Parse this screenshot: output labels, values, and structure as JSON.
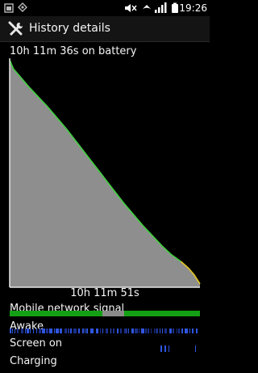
{
  "status_bar": {
    "time": "19:26",
    "icons": [
      "notification-icon",
      "usb-debug-icon",
      "mute-icon",
      "wifi-icon",
      "signal-icon",
      "battery-icon"
    ]
  },
  "header": {
    "title": "History details",
    "icon": "wrench-screwdriver-icon"
  },
  "battery": {
    "time_on_battery": "10h 11m 36s on battery",
    "graph_duration": "10h 11m 51s"
  },
  "rows": {
    "mobile_signal": "Mobile network signal",
    "awake": "Awake",
    "screen_on": "Screen on",
    "charging": "Charging"
  },
  "chart_data": {
    "type": "area",
    "title": "10h 11m 36s on battery",
    "xlabel": "10h 11m 51s",
    "ylabel": "",
    "x": [
      0,
      0.02,
      0.05,
      0.1,
      0.2,
      0.3,
      0.4,
      0.5,
      0.6,
      0.7,
      0.8,
      0.85,
      0.9,
      0.94,
      0.97,
      1.0
    ],
    "values": [
      100,
      96,
      93,
      88,
      79,
      69,
      58,
      47,
      36,
      26,
      17,
      13,
      10,
      7,
      4,
      0
    ],
    "x_unit": "fraction of battery time",
    "y_unit": "relative battery level",
    "colors": {
      "fill": "#8e8e8e",
      "line": "#3fcf3f",
      "line_low": "#e8c81a",
      "axis": "#e6e6e6"
    },
    "grid": false
  }
}
